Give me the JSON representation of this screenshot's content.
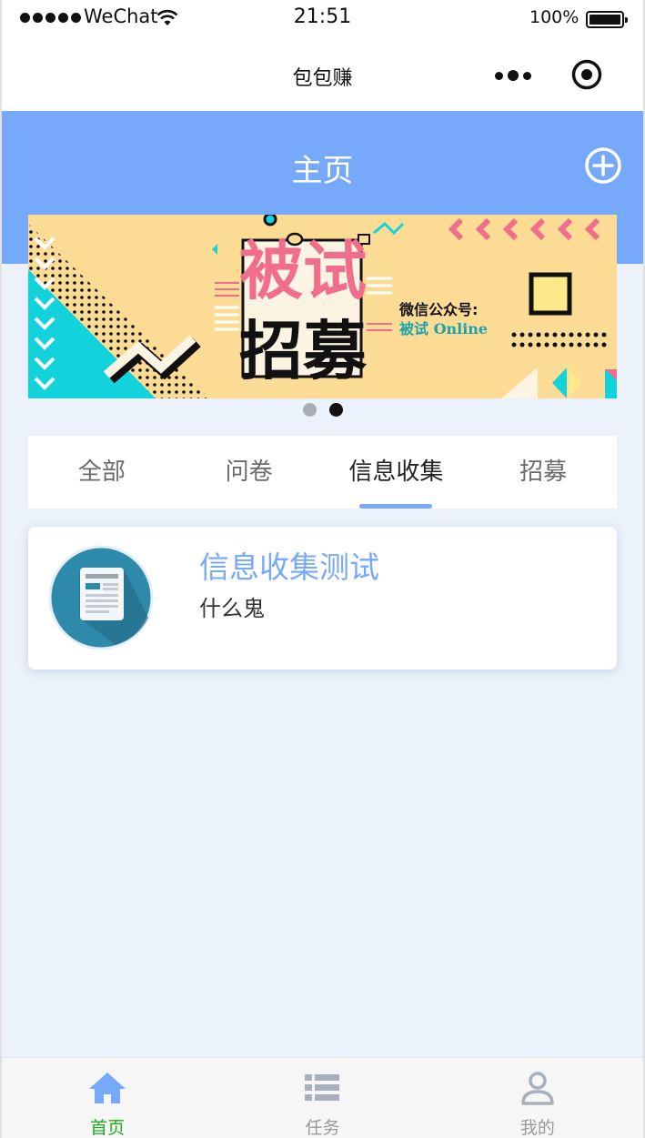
{
  "status_bar": {
    "carrier": "WeChat",
    "time": "21:51",
    "battery_percent": "100%",
    "battery_level": 1.0
  },
  "nav": {
    "title": "包包赚",
    "more_icon": "more-dots-icon",
    "close_icon": "target-close-icon"
  },
  "header": {
    "title": "主页",
    "add_icon": "plus-circle-icon",
    "color": "#77a9fb"
  },
  "banner": {
    "line1": "被试",
    "line2": "招募",
    "caption1": "微信公众号:",
    "caption2": "被试 Online",
    "pager_count": 2,
    "pager_active": 1
  },
  "tabs": [
    {
      "label": "全部",
      "active": false
    },
    {
      "label": "问卷",
      "active": false
    },
    {
      "label": "信息收集",
      "active": true
    },
    {
      "label": "招募",
      "active": false
    }
  ],
  "card": {
    "title": "信息收集测试",
    "description": "什么鬼",
    "icon": "document-icon"
  },
  "tabbar": [
    {
      "label": "首页",
      "icon": "home-icon",
      "active": true
    },
    {
      "label": "任务",
      "icon": "list-icon",
      "active": false
    },
    {
      "label": "我的",
      "icon": "user-icon",
      "active": false
    }
  ],
  "colors": {
    "accent": "#77a9fb",
    "tabbar_active": "#1aad19",
    "tabbar_inactive": "#999999",
    "page_bg": "#ebf2fb"
  }
}
